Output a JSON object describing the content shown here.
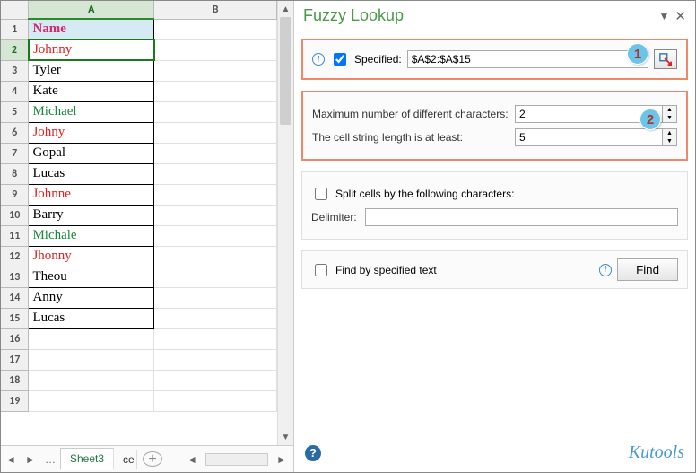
{
  "columns": [
    "A",
    "B"
  ],
  "rows_shown": 19,
  "header_cell": "Name",
  "active_row": 2,
  "cells": [
    {
      "text": "Johnny",
      "cls": "c-red"
    },
    {
      "text": "Tyler",
      "cls": ""
    },
    {
      "text": "Kate",
      "cls": ""
    },
    {
      "text": "Michael",
      "cls": "c-green"
    },
    {
      "text": "Johny",
      "cls": "c-red"
    },
    {
      "text": "Gopal",
      "cls": ""
    },
    {
      "text": "Lucas",
      "cls": ""
    },
    {
      "text": "Johnne",
      "cls": "c-red"
    },
    {
      "text": "Barry",
      "cls": ""
    },
    {
      "text": "Michale",
      "cls": "c-green"
    },
    {
      "text": "Jhonny",
      "cls": "c-red"
    },
    {
      "text": "Theou",
      "cls": ""
    },
    {
      "text": "Anny",
      "cls": ""
    },
    {
      "text": "Lucas",
      "cls": ""
    }
  ],
  "tabs": {
    "active": "Sheet3",
    "next": "ce"
  },
  "panel": {
    "title": "Fuzzy Lookup",
    "specified_label": "Specified:",
    "specified_checked": true,
    "specified_value": "$A$2:$A$15",
    "max_diff_label": "Maximum number of different characters:",
    "max_diff_value": "2",
    "min_len_label": "The cell string length is at least:",
    "min_len_value": "5",
    "split_label": "Split cells by the following characters:",
    "split_checked": false,
    "delimiter_label": "Delimiter:",
    "delimiter_value": "",
    "findby_label": "Find by specified text",
    "findby_checked": false,
    "find_btn": "Find",
    "brand": "Kutools",
    "badge1": "1",
    "badge2": "2"
  }
}
